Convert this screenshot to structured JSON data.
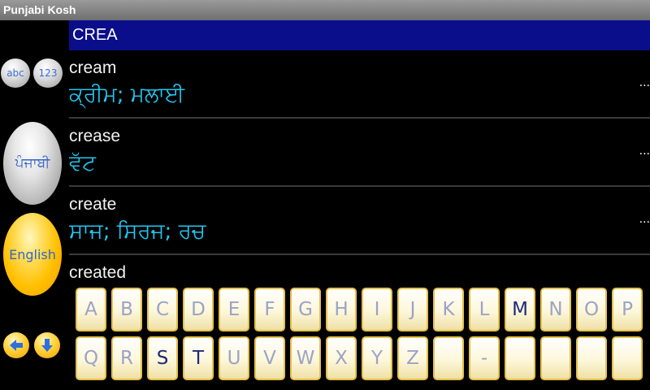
{
  "app": {
    "title": "Punjabi Kosh"
  },
  "search": {
    "query": "CREA"
  },
  "sidebar": {
    "abc_label": "abc",
    "num_label": "123",
    "punjabi_label": "ਪੰਜਾਬੀ",
    "english_label": "English",
    "left_arrow_icon": "arrow-left-icon",
    "down_arrow_icon": "arrow-down-icon"
  },
  "results": [
    {
      "en": "cream",
      "pa": "ਕ੍ਰੀਮ; ਮਲਾਈ",
      "more": "..."
    },
    {
      "en": "crease",
      "pa": "ਵੱਟ",
      "more": "..."
    },
    {
      "en": "create",
      "pa": "ਸਾਜ; ਸਿਰਜ; ਰਚ",
      "more": "..."
    },
    {
      "en": "created",
      "pa": "",
      "more": ""
    }
  ],
  "keyboard": {
    "row1": [
      "A",
      "B",
      "C",
      "D",
      "E",
      "F",
      "G",
      "H",
      "I",
      "J",
      "K",
      "L",
      "M",
      "N",
      "O",
      "P"
    ],
    "row2": [
      "Q",
      "R",
      "S",
      "T",
      "U",
      "V",
      "W",
      "X",
      "Y",
      "Z",
      "",
      "-",
      "",
      "",
      "",
      ""
    ],
    "highlighted": [
      "M",
      "S",
      "T"
    ]
  },
  "colors": {
    "searchbar": "#0b0e8a",
    "punjabi_text": "#22c6f0",
    "key_border": "#e6c14a"
  }
}
